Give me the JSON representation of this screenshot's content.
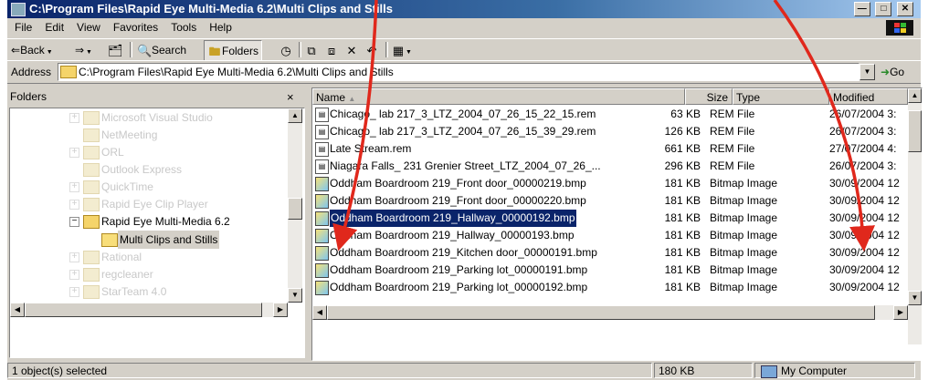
{
  "window": {
    "title": "C:\\Program Files\\Rapid Eye Multi-Media 6.2\\Multi Clips and Stills"
  },
  "menu": [
    "File",
    "Edit",
    "View",
    "Favorites",
    "Tools",
    "Help"
  ],
  "toolbar": {
    "back": "Back",
    "search": "Search",
    "folders": "Folders"
  },
  "address": {
    "label": "Address",
    "value": "C:\\Program Files\\Rapid Eye Multi-Media 6.2\\Multi Clips and Stills",
    "go": "Go"
  },
  "folders_pane": {
    "title": "Folders",
    "close": "×",
    "items": [
      {
        "label": "Microsoft Visual Studio"
      },
      {
        "label": "NetMeeting"
      },
      {
        "label": "ORL"
      },
      {
        "label": "Outlook Express"
      },
      {
        "label": "QuickTime"
      },
      {
        "label": "Rapid Eye Clip Player"
      },
      {
        "label": "Rapid Eye Multi-Media 6.2"
      },
      {
        "label": "Multi Clips and Stills"
      },
      {
        "label": "Rational"
      },
      {
        "label": "regcleaner"
      },
      {
        "label": "StarTeam 4.0"
      }
    ]
  },
  "files": {
    "columns": [
      "Name",
      "Size",
      "Type",
      "Modified"
    ],
    "rows": [
      {
        "name": "Chicago_ lab 217_3_LTZ_2004_07_26_15_22_15.rem",
        "size": "63 KB",
        "type": "REM File",
        "modified": "26/07/2004 3:"
      },
      {
        "name": "Chicago_ lab 217_3_LTZ_2004_07_26_15_39_29.rem",
        "size": "126 KB",
        "type": "REM File",
        "modified": "26/07/2004 3:"
      },
      {
        "name": "Late Stream.rem",
        "size": "661 KB",
        "type": "REM File",
        "modified": "27/07/2004 4:"
      },
      {
        "name": "Niagara Falls_ 231 Grenier Street_LTZ_2004_07_26_...",
        "size": "296 KB",
        "type": "REM File",
        "modified": "26/07/2004 3:"
      },
      {
        "name": "Oddham Boardroom 219_Front door_00000219.bmp",
        "size": "181 KB",
        "type": "Bitmap Image",
        "modified": "30/09/2004 12"
      },
      {
        "name": "Oddham Boardroom 219_Front door_00000220.bmp",
        "size": "181 KB",
        "type": "Bitmap Image",
        "modified": "30/09/2004 12"
      },
      {
        "name": "Oddham Boardroom 219_Hallway_00000192.bmp",
        "size": "181 KB",
        "type": "Bitmap Image",
        "modified": "30/09/2004 12"
      },
      {
        "name": "Oddham Boardroom 219_Hallway_00000193.bmp",
        "size": "181 KB",
        "type": "Bitmap Image",
        "modified": "30/09/2004 12"
      },
      {
        "name": "Oddham Boardroom 219_Kitchen door_00000191.bmp",
        "size": "181 KB",
        "type": "Bitmap Image",
        "modified": "30/09/2004 12"
      },
      {
        "name": "Oddham Boardroom 219_Parking lot_00000191.bmp",
        "size": "181 KB",
        "type": "Bitmap Image",
        "modified": "30/09/2004 12"
      },
      {
        "name": "Oddham Boardroom 219_Parking lot_00000192.bmp",
        "size": "181 KB",
        "type": "Bitmap Image",
        "modified": "30/09/2004 12"
      }
    ]
  },
  "status": {
    "selection": "1 object(s) selected",
    "size": "180 KB",
    "zone": "My Computer"
  },
  "colors": {
    "title_start": "#0a246a",
    "title_end": "#a6caf0",
    "face": "#d4d0c8",
    "selection": "#0a246a",
    "annotation_arrow": "#e0281c"
  }
}
